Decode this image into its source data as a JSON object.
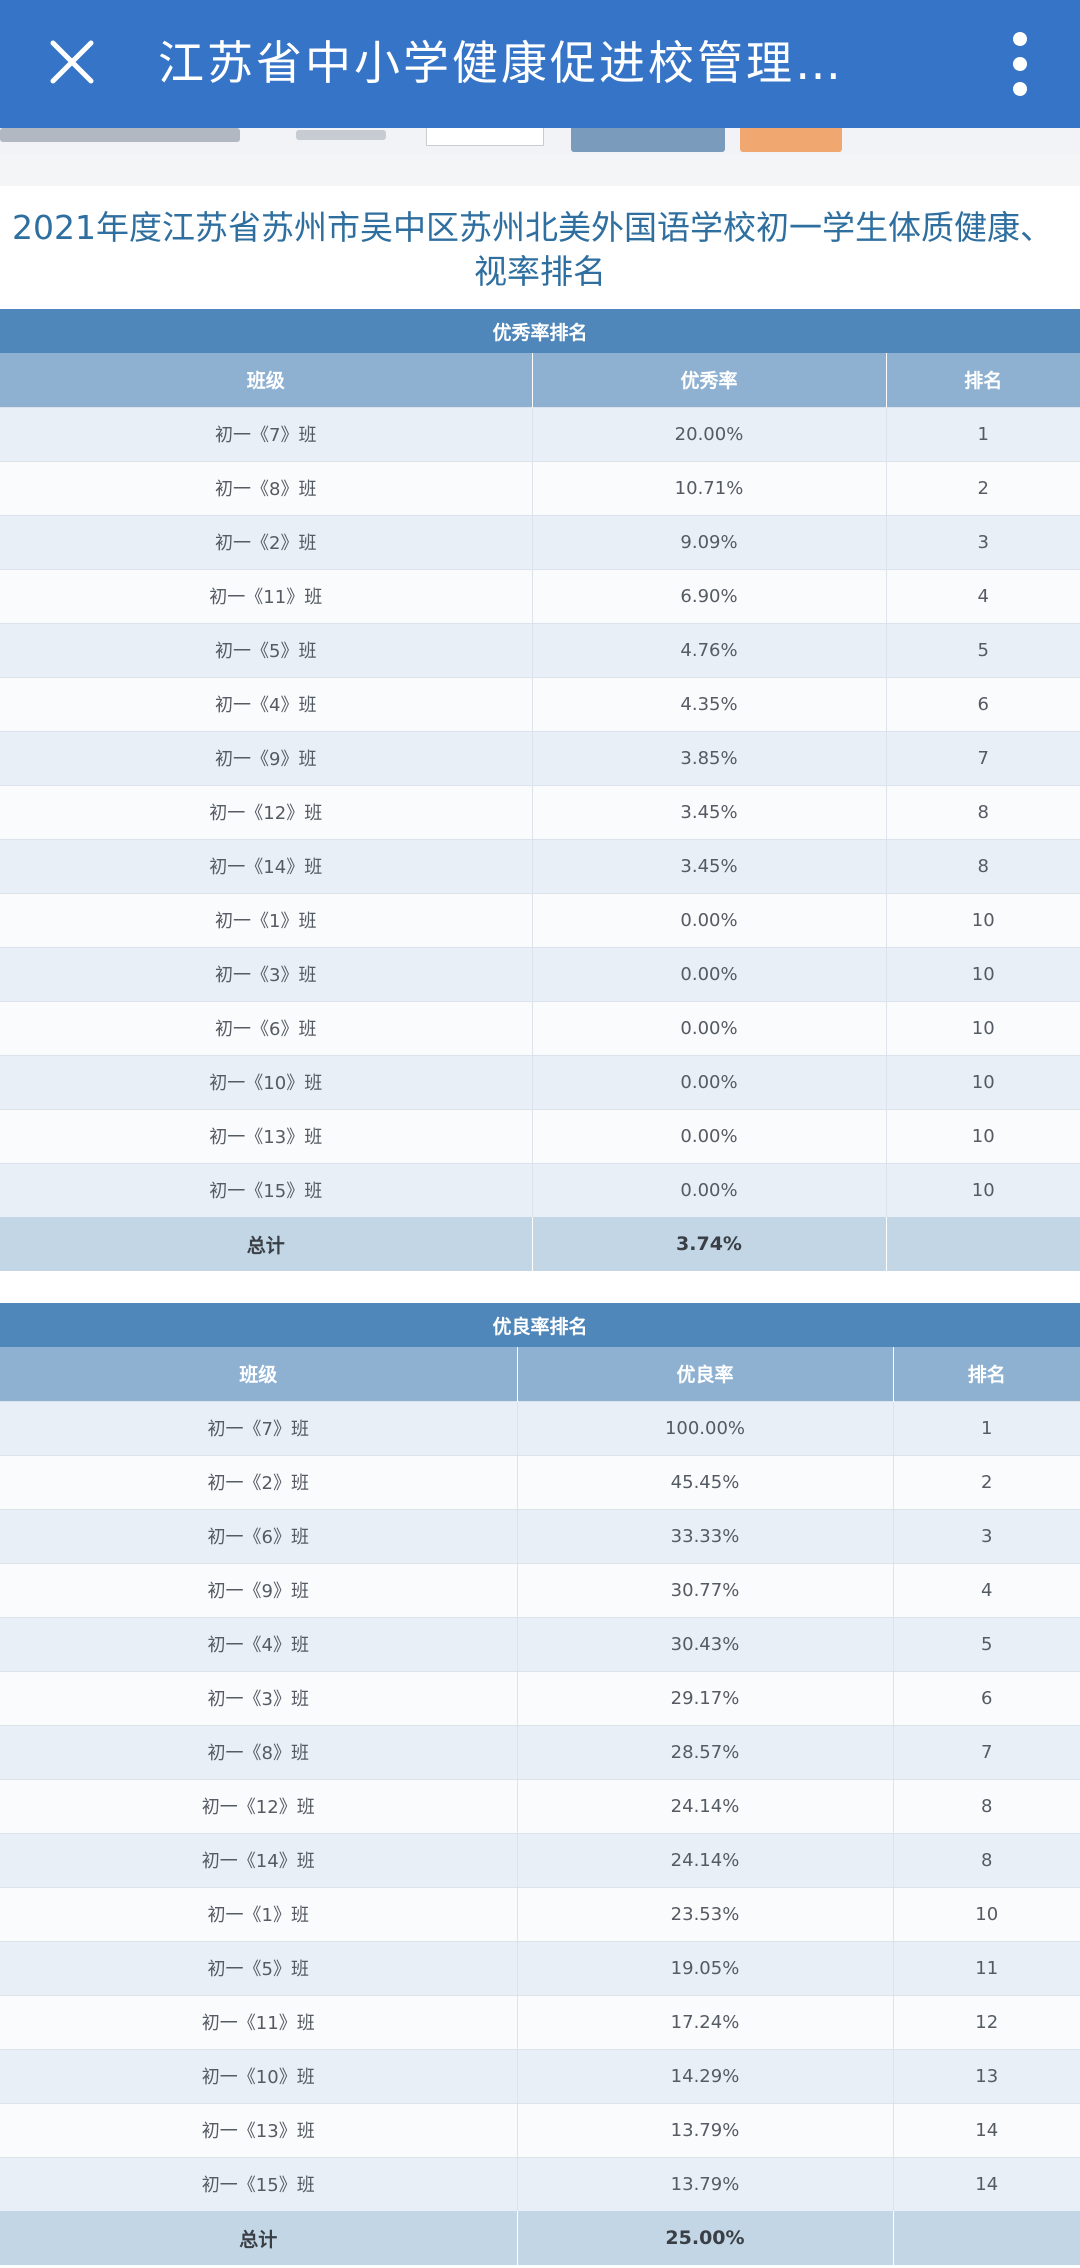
{
  "appbar": {
    "title": "江苏省中小学健康促进校管理…",
    "close_icon": "close-icon",
    "more_icon": "more-vertical-icon"
  },
  "report": {
    "title_line1": "2021年度江苏省苏州市吴中区苏州北美外国语学校初一学生体质健康、",
    "title_line2": "视率排名"
  },
  "excellent": {
    "section_title": "优秀率排名",
    "headers": [
      "班级",
      "优秀率",
      "排名"
    ],
    "rows": [
      {
        "class": "初一《7》班",
        "rate": "20.00%",
        "rank": "1"
      },
      {
        "class": "初一《8》班",
        "rate": "10.71%",
        "rank": "2"
      },
      {
        "class": "初一《2》班",
        "rate": "9.09%",
        "rank": "3"
      },
      {
        "class": "初一《11》班",
        "rate": "6.90%",
        "rank": "4"
      },
      {
        "class": "初一《5》班",
        "rate": "4.76%",
        "rank": "5"
      },
      {
        "class": "初一《4》班",
        "rate": "4.35%",
        "rank": "6"
      },
      {
        "class": "初一《9》班",
        "rate": "3.85%",
        "rank": "7"
      },
      {
        "class": "初一《12》班",
        "rate": "3.45%",
        "rank": "8"
      },
      {
        "class": "初一《14》班",
        "rate": "3.45%",
        "rank": "8"
      },
      {
        "class": "初一《1》班",
        "rate": "0.00%",
        "rank": "10"
      },
      {
        "class": "初一《3》班",
        "rate": "0.00%",
        "rank": "10"
      },
      {
        "class": "初一《6》班",
        "rate": "0.00%",
        "rank": "10"
      },
      {
        "class": "初一《10》班",
        "rate": "0.00%",
        "rank": "10"
      },
      {
        "class": "初一《13》班",
        "rate": "0.00%",
        "rank": "10"
      },
      {
        "class": "初一《15》班",
        "rate": "0.00%",
        "rank": "10"
      }
    ],
    "total_label": "总计",
    "total_rate": "3.74%"
  },
  "good": {
    "section_title": "优良率排名",
    "headers": [
      "班级",
      "优良率",
      "排名"
    ],
    "rows": [
      {
        "class": "初一《7》班",
        "rate": "100.00%",
        "rank": "1"
      },
      {
        "class": "初一《2》班",
        "rate": "45.45%",
        "rank": "2"
      },
      {
        "class": "初一《6》班",
        "rate": "33.33%",
        "rank": "3"
      },
      {
        "class": "初一《9》班",
        "rate": "30.77%",
        "rank": "4"
      },
      {
        "class": "初一《4》班",
        "rate": "30.43%",
        "rank": "5"
      },
      {
        "class": "初一《3》班",
        "rate": "29.17%",
        "rank": "6"
      },
      {
        "class": "初一《8》班",
        "rate": "28.57%",
        "rank": "7"
      },
      {
        "class": "初一《12》班",
        "rate": "24.14%",
        "rank": "8"
      },
      {
        "class": "初一《14》班",
        "rate": "24.14%",
        "rank": "8"
      },
      {
        "class": "初一《1》班",
        "rate": "23.53%",
        "rank": "10"
      },
      {
        "class": "初一《5》班",
        "rate": "19.05%",
        "rank": "11"
      },
      {
        "class": "初一《11》班",
        "rate": "17.24%",
        "rank": "12"
      },
      {
        "class": "初一《10》班",
        "rate": "14.29%",
        "rank": "13"
      },
      {
        "class": "初一《13》班",
        "rate": "13.79%",
        "rank": "14"
      },
      {
        "class": "初一《15》班",
        "rate": "13.79%",
        "rank": "14"
      }
    ],
    "total_label": "总计",
    "total_rate": "25.00%"
  },
  "colors": {
    "appbar": "#3574c6",
    "section_header": "#4f87ba",
    "column_header": "#8eb1d2",
    "row_alt": "#e9eff7",
    "total_row": "#c2d6e6",
    "title_text": "#2f6f9f"
  }
}
